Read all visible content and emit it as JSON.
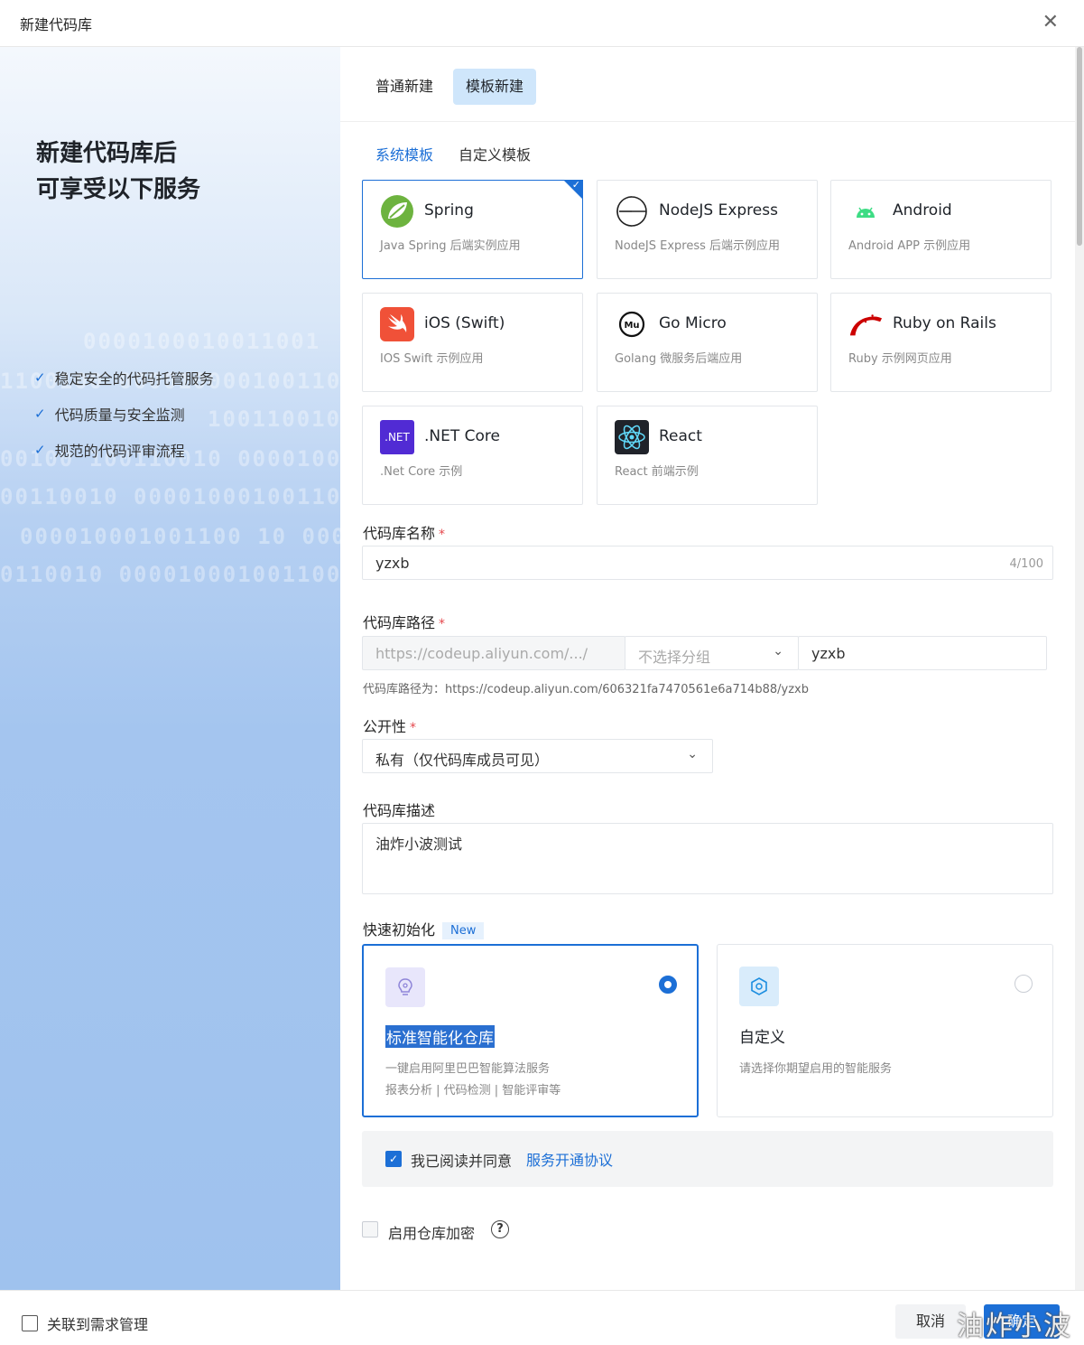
{
  "dialog": {
    "title": "新建代码库"
  },
  "left": {
    "hero_line1": "新建代码库后",
    "hero_line2": "可享受以下服务",
    "features": [
      "稳定安全的代码托管服务",
      "代码质量与安全监测",
      "规范的代码评审流程"
    ]
  },
  "modes": [
    "普通新建",
    "模板新建"
  ],
  "subtabs": [
    "系统模板",
    "自定义模板"
  ],
  "templates": [
    {
      "name": "Spring",
      "desc": "Java Spring 后端实例应用",
      "icon": "spring-icon",
      "selected": true
    },
    {
      "name": "NodeJS Express",
      "desc": "NodeJS Express 后端示例应用",
      "icon": "express-icon"
    },
    {
      "name": "Android",
      "desc": "Android APP 示例应用",
      "icon": "android-icon"
    },
    {
      "name": "iOS (Swift)",
      "desc": "IOS Swift 示例应用",
      "icon": "swift-icon"
    },
    {
      "name": "Go Micro",
      "desc": "Golang 微服务后端应用",
      "icon": "go-micro-icon"
    },
    {
      "name": "Ruby on Rails",
      "desc": "Ruby 示例网页应用",
      "icon": "rails-icon"
    },
    {
      "name": ".NET Core",
      "desc": ".Net Core 示例",
      "icon": "dotnet-icon",
      "icon_text": ".NET"
    },
    {
      "name": "React",
      "desc": "React 前端示例",
      "icon": "react-icon"
    }
  ],
  "form": {
    "name_label": "代码库名称",
    "name_value": "yzxb",
    "name_count": "4/100",
    "path_label": "代码库路径",
    "path_prefix": "https://codeup.aliyun.com/.../",
    "path_group_placeholder": "不选择分组",
    "path_value": "yzxb",
    "path_hint": "代码库路径为：https://codeup.aliyun.com/606321fa7470561e6a714b88/yzxb",
    "visibility_label": "公开性",
    "visibility_value": "私有（仅代码库成员可见）",
    "desc_label": "代码库描述",
    "desc_value": "油炸小波测试",
    "init_label": "快速初始化",
    "init_badge": "New"
  },
  "init_options": [
    {
      "title": "标准智能化仓库",
      "line1": "一键启用阿里巴巴智能算法服务",
      "line2": "报表分析 | 代码检测 | 智能评审等",
      "selected": true
    },
    {
      "title": "自定义",
      "line1": "请选择你期望启用的智能服务",
      "selected": false
    }
  ],
  "agreement": {
    "text": "我已阅读并同意",
    "link": "服务开通协议",
    "checked": true
  },
  "encryption": {
    "label": "启用仓库加密",
    "help": "?",
    "checked": false
  },
  "footer": {
    "link_req": "关联到需求管理",
    "cancel": "取消",
    "ok": "确定"
  },
  "watermark": "油炸小波",
  "colors": {
    "accent": "#1c6fd6",
    "required": "#e5484d"
  }
}
